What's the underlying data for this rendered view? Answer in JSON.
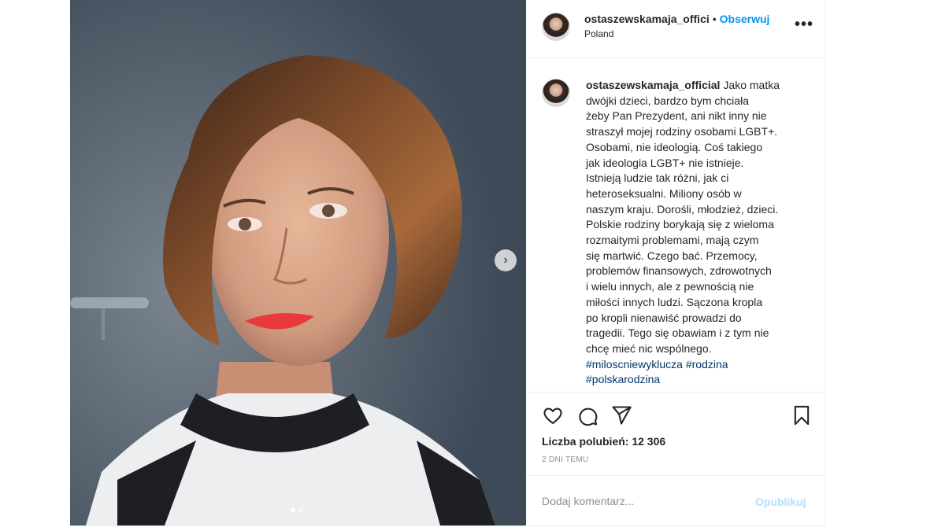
{
  "post": {
    "username": "ostaszewskamaja_offici",
    "separator": "•",
    "follow_label": "Obserwuj",
    "location": "Poland",
    "more_label": "•••"
  },
  "caption": {
    "username": "ostaszewskamaja_official",
    "lines": [
      "Jako matka",
      "dwójki dzieci, bardzo bym chciała",
      "żeby Pan Prezydent, ani nikt inny nie",
      "straszył mojej rodziny osobami LGBT+.",
      "Osobami, nie ideologią. Coś takiego",
      "jak ideologia LGBT+ nie istnieje.",
      "Istnieją ludzie tak różni, jak ci",
      "heteroseksualni. Miliony osób w",
      "naszym kraju. Dorośli, młodzież, dzieci.",
      "Polskie rodziny borykają się z wieloma",
      "rozmaitymi problemami, mają czym",
      "się martwić. Czego bać. Przemocy,",
      "problemów finansowych, zdrowotnych",
      "i wielu innych, ale z pewnością nie",
      "miłości innych ludzi. Sączona kropla",
      "po kropli nienawiść prowadzi do",
      "tragedii. Tego się obawiam i z tym nie",
      "chcę mieć nic wspólnego."
    ],
    "hashtags": [
      "#miloscniewyklucza",
      "#rodzina",
      "#polskarodzina"
    ]
  },
  "actions": {
    "likes_text": "Liczba polubień: 12 306",
    "time_ago": "2 DNI TEMU"
  },
  "comment": {
    "placeholder": "Dodaj komentarz...",
    "publish_label": "Opublikuj"
  },
  "carousel": {
    "next_icon": "›",
    "slide_count": 2,
    "active_slide": 1
  },
  "colors": {
    "accent": "#0095f6",
    "hashtag": "#00376b",
    "muted": "#8e8e8e",
    "publish_disabled": "#b2dffc"
  }
}
